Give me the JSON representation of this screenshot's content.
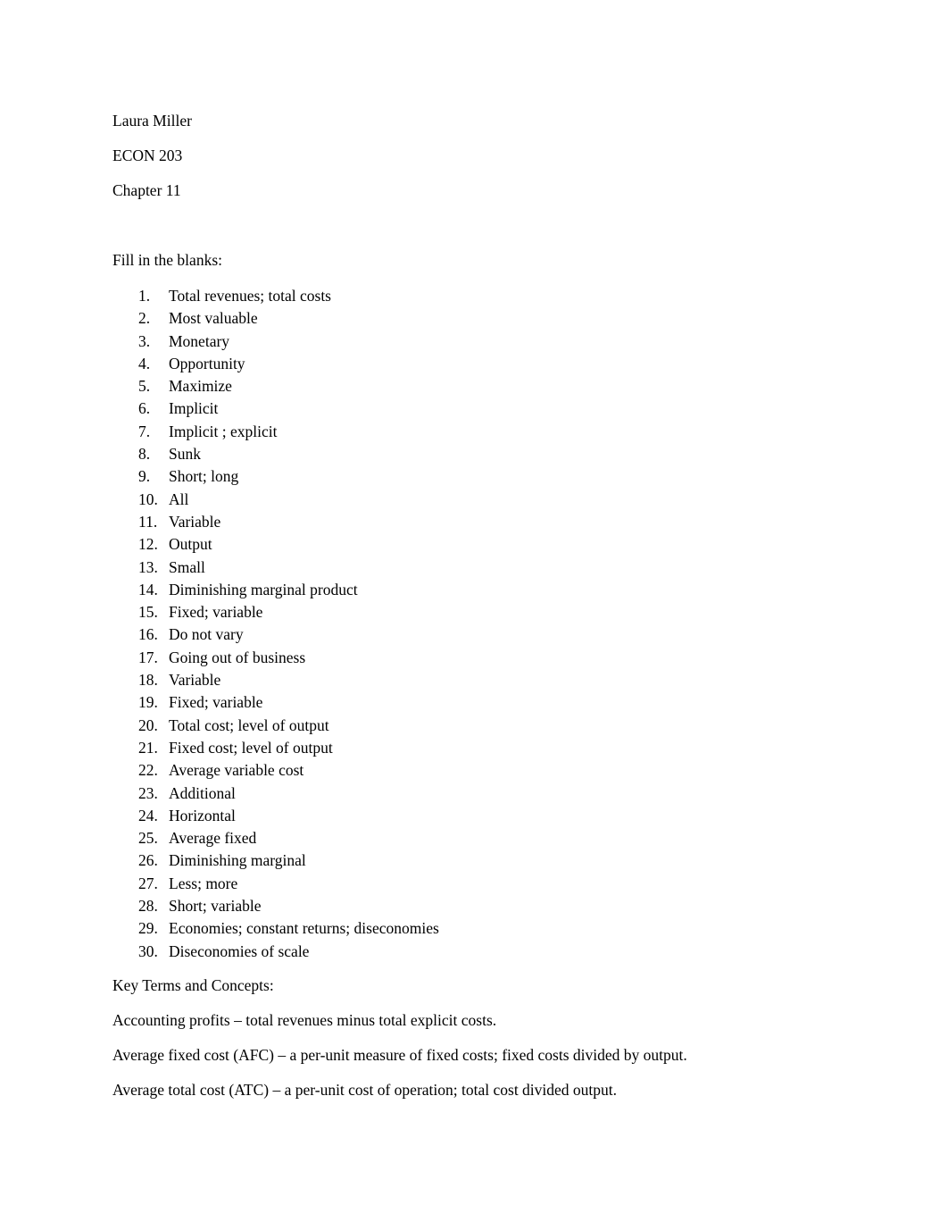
{
  "document": {
    "header": {
      "author": "Laura Miller",
      "course": "ECON 203",
      "chapter": "Chapter 11"
    },
    "sections": {
      "fill_in_the_blanks_heading": "Fill in the blanks:",
      "key_terms_heading": "Key Terms and Concepts:"
    },
    "answers": [
      {
        "number": "1.",
        "text": "Total revenues; total costs"
      },
      {
        "number": "2.",
        "text": "Most valuable"
      },
      {
        "number": "3.",
        "text": "Monetary"
      },
      {
        "number": "4.",
        "text": "Opportunity"
      },
      {
        "number": "5.",
        "text": "Maximize"
      },
      {
        "number": "6.",
        "text": "Implicit"
      },
      {
        "number": "7.",
        "text": "Implicit ; explicit"
      },
      {
        "number": "8.",
        "text": "Sunk"
      },
      {
        "number": "9.",
        "text": "Short; long"
      },
      {
        "number": "10.",
        "text": "All"
      },
      {
        "number": "11.",
        "text": "Variable"
      },
      {
        "number": "12.",
        "text": "Output"
      },
      {
        "number": "13.",
        "text": "Small"
      },
      {
        "number": "14.",
        "text": "Diminishing marginal product"
      },
      {
        "number": "15.",
        "text": "Fixed; variable"
      },
      {
        "number": "16.",
        "text": "Do not vary"
      },
      {
        "number": "17.",
        "text": "Going out of business"
      },
      {
        "number": "18.",
        "text": "Variable"
      },
      {
        "number": "19.",
        "text": "Fixed; variable"
      },
      {
        "number": "20.",
        "text": "Total cost; level of output"
      },
      {
        "number": "21.",
        "text": "Fixed cost; level of output"
      },
      {
        "number": "22.",
        "text": "Average variable cost"
      },
      {
        "number": "23.",
        "text": "Additional"
      },
      {
        "number": "24.",
        "text": "Horizontal"
      },
      {
        "number": "25.",
        "text": "Average fixed"
      },
      {
        "number": "26.",
        "text": "Diminishing marginal"
      },
      {
        "number": "27.",
        "text": "Less; more"
      },
      {
        "number": "28.",
        "text": "Short; variable"
      },
      {
        "number": "29.",
        "text": "Economies; constant returns; diseconomies"
      },
      {
        "number": "30.",
        "text": "Diseconomies of scale"
      }
    ],
    "definitions": [
      "Accounting profits – total revenues minus total explicit costs.",
      "Average fixed cost (AFC) – a per-unit measure of fixed costs; fixed costs divided by output.",
      "Average total cost (ATC) – a per-unit cost of operation; total cost divided output."
    ]
  }
}
